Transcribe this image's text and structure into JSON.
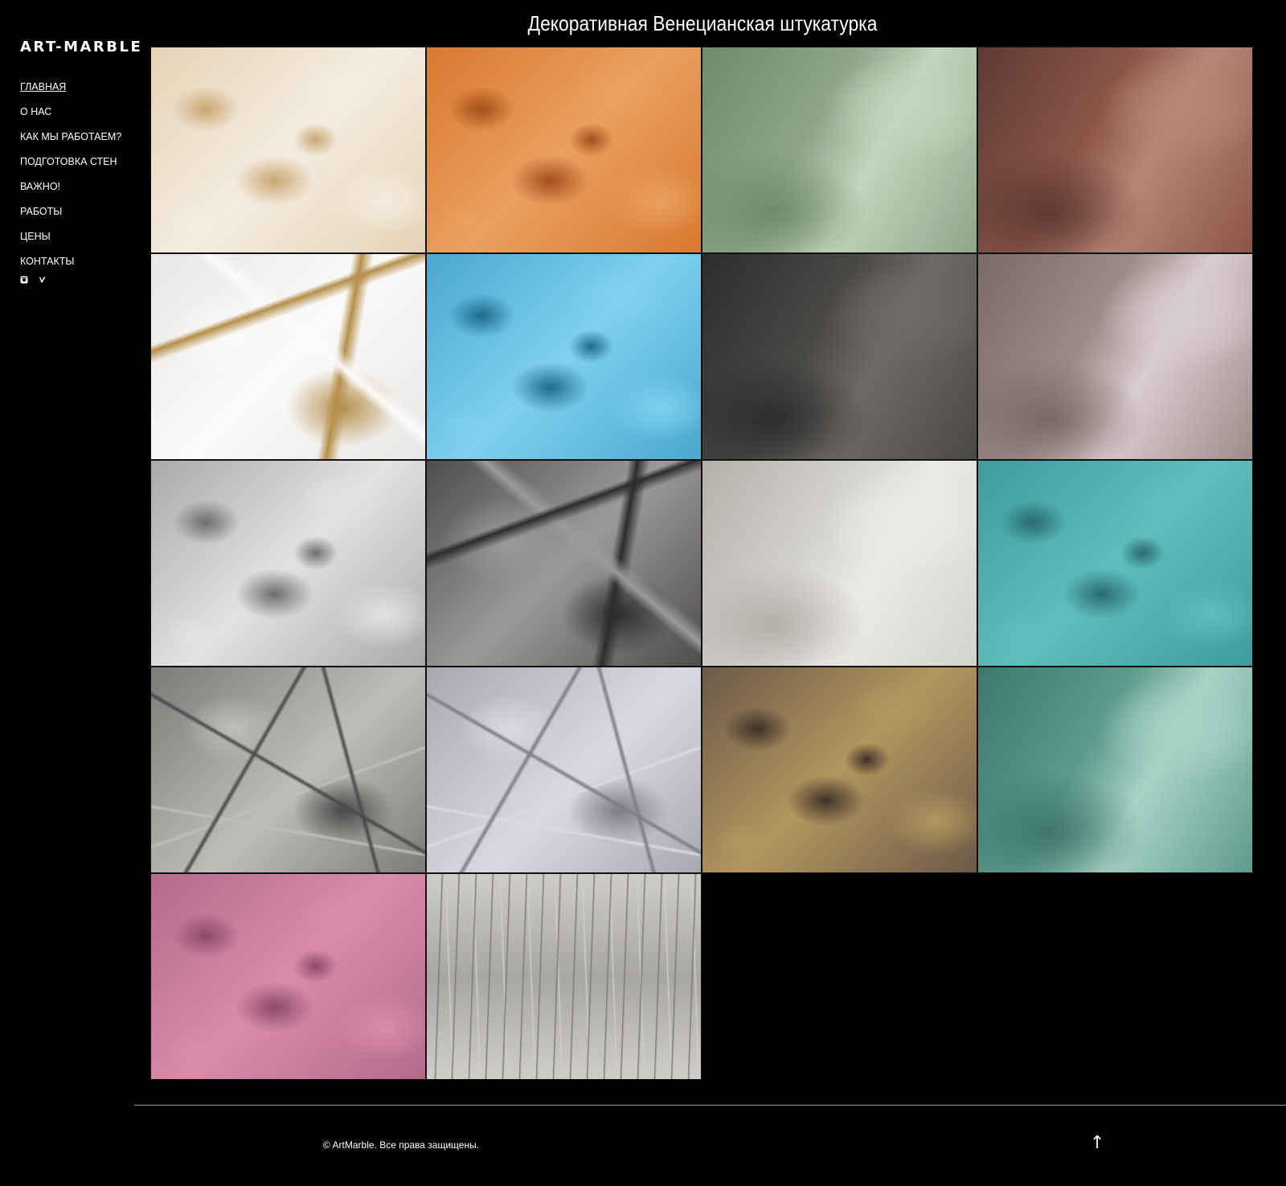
{
  "brand": {
    "logo_text": "ART-MARBLE"
  },
  "page": {
    "title": "Декоративная Венецианская штукатурка"
  },
  "nav": {
    "items": [
      {
        "label": "ГЛАВНАЯ",
        "active": true
      },
      {
        "label": "О НАС",
        "active": false
      },
      {
        "label": "КАК МЫ РАБОТАЕМ?",
        "active": false
      },
      {
        "label": "ПОДГОТОВКА СТЕН",
        "active": false
      },
      {
        "label": "ВАЖНО!",
        "active": false
      },
      {
        "label": "РАБОТЫ",
        "active": false
      },
      {
        "label": "ЦЕНЫ",
        "active": false
      },
      {
        "label": "КОНТАКТЫ",
        "active": false
      }
    ],
    "social": [
      {
        "icon": "instagram-icon"
      },
      {
        "icon": "vimeo-icon"
      }
    ]
  },
  "gallery": {
    "tiles": [
      {
        "name": "beige-plaster",
        "base": "#e6d3b6",
        "accent": "#c9a672",
        "light": "#f4ece0",
        "style": "mottled"
      },
      {
        "name": "orange-plaster",
        "base": "#d9782f",
        "accent": "#a54e1c",
        "light": "#e9a060",
        "style": "mottled"
      },
      {
        "name": "sage-green-plaster",
        "base": "#8ea58a",
        "accent": "#6f8a6d",
        "light": "#c3d5bc",
        "style": "smooth"
      },
      {
        "name": "copper-brown-plaster",
        "base": "#8a5548",
        "accent": "#5e3a33",
        "light": "#b98676",
        "style": "smooth"
      },
      {
        "name": "onyx-marble",
        "base": "#e9e7e4",
        "accent": "#b58f4a",
        "light": "#fbfaf8",
        "style": "marble"
      },
      {
        "name": "blue-plaster",
        "base": "#4aa7cf",
        "accent": "#1f6b8c",
        "light": "#7fd0ee",
        "style": "mottled"
      },
      {
        "name": "graphite-plaster",
        "base": "#4a4845",
        "accent": "#2e2d2b",
        "light": "#6e6b67",
        "style": "smooth"
      },
      {
        "name": "mauve-gloss-plaster",
        "base": "#9d8b88",
        "accent": "#7a6964",
        "light": "#d9ccd0",
        "style": "smooth"
      },
      {
        "name": "silver-grey-plaster",
        "base": "#a9a9ab",
        "accent": "#6d6d70",
        "light": "#e2e2e2",
        "style": "mottled"
      },
      {
        "name": "dark-marble",
        "base": "#4f4d4c",
        "accent": "#2d2c2b",
        "light": "#9b9a98",
        "style": "marble"
      },
      {
        "name": "light-grey-plaster",
        "base": "#d4d2cd",
        "accent": "#b3b0aa",
        "light": "#eceae6",
        "style": "smooth"
      },
      {
        "name": "teal-plaster",
        "base": "#3f9c9c",
        "accent": "#2a6a70",
        "light": "#5fbdbb",
        "style": "mottled"
      },
      {
        "name": "grey-relief-plaster",
        "base": "#7c7b78",
        "accent": "#4a4947",
        "light": "#bfbdb8",
        "style": "cracked"
      },
      {
        "name": "crackle-plaster",
        "base": "#a8a8b2",
        "accent": "#7d7d88",
        "light": "#d9d9e3",
        "style": "cracked"
      },
      {
        "name": "rusty-stone-plaster",
        "base": "#6a5a48",
        "accent": "#3e3229",
        "light": "#b3955e",
        "style": "mottled"
      },
      {
        "name": "mint-plaster",
        "base": "#5e9a8d",
        "accent": "#3f776c",
        "light": "#a7d3c6",
        "style": "smooth"
      },
      {
        "name": "pink-plaster",
        "base": "#b56a8c",
        "accent": "#8c4a6a",
        "light": "#d98ba8",
        "style": "mottled"
      },
      {
        "name": "grey-travertine-plaster",
        "base": "#a7a6a2",
        "accent": "#7d7a72",
        "light": "#cfcdc9",
        "style": "streaked"
      }
    ]
  },
  "footer": {
    "copyright": "© ArtMarble. Все права защищены.",
    "to_top": "↑"
  }
}
